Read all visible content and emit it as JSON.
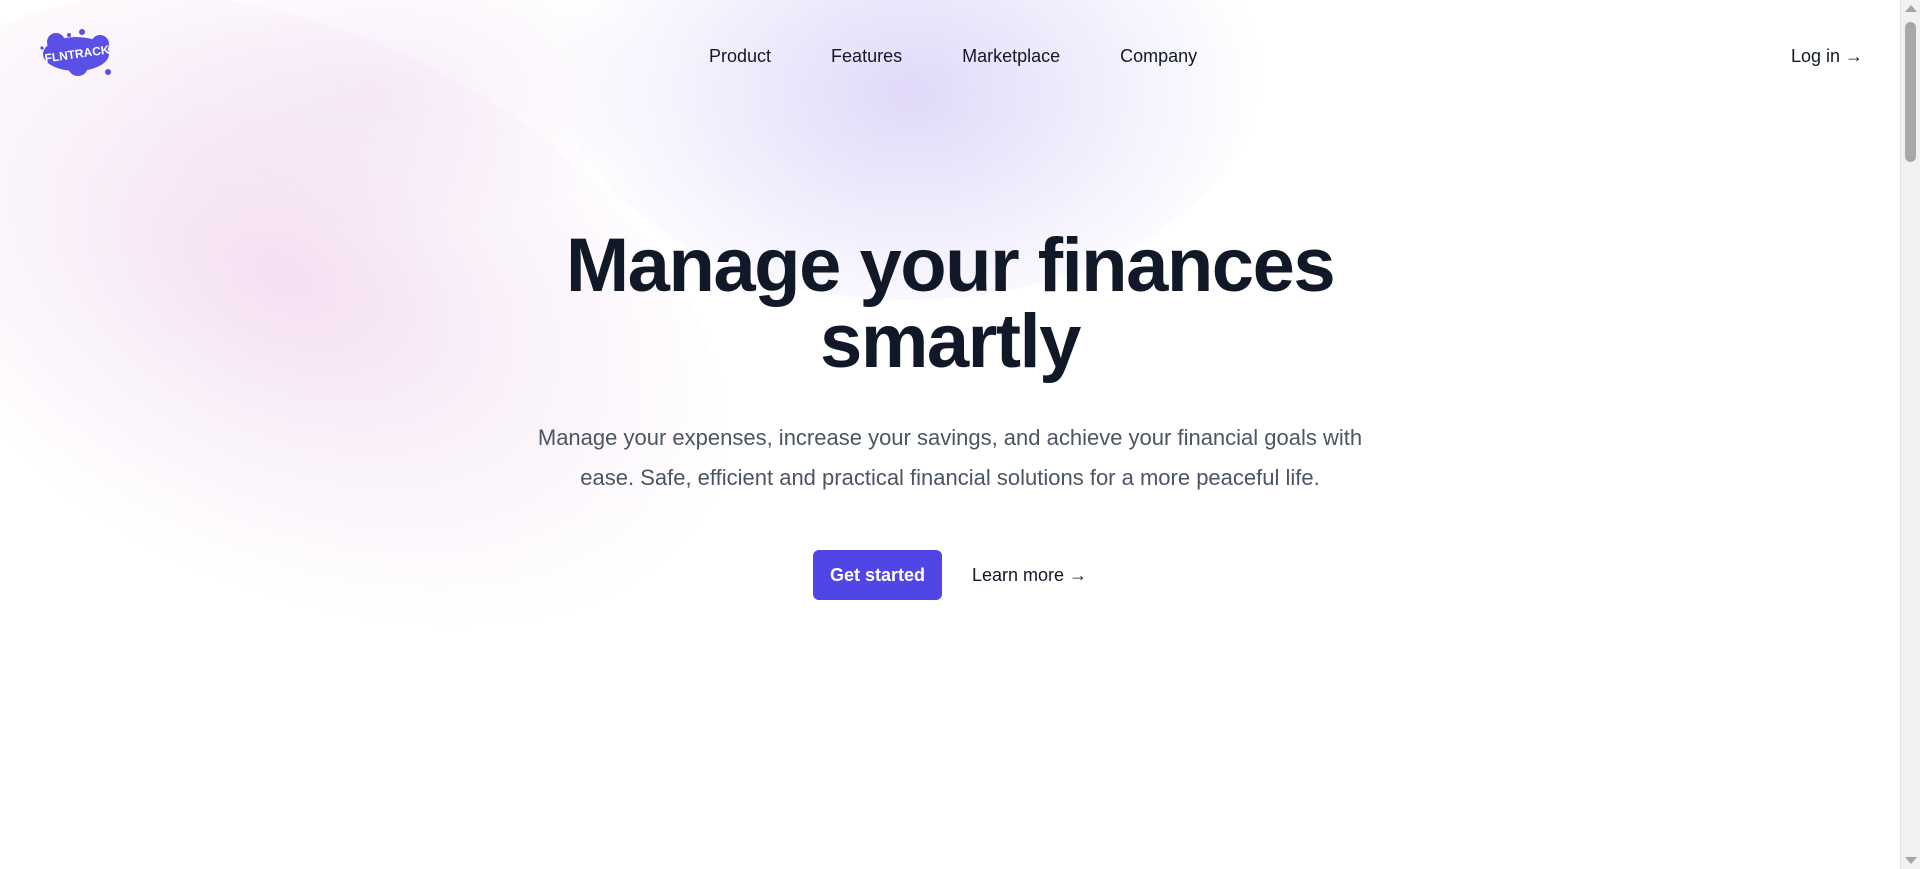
{
  "header": {
    "logo_text": "FLNTRACK",
    "nav": [
      {
        "label": "Product"
      },
      {
        "label": "Features"
      },
      {
        "label": "Marketplace"
      },
      {
        "label": "Company"
      }
    ],
    "login_label": "Log in →"
  },
  "hero": {
    "title_line1": "Manage your finances",
    "title_line2": "smartly",
    "subtitle": "Manage your expenses, increase your savings, and achieve your financial goals with ease. Safe, efficient and practical financial solutions for a more peaceful life.",
    "primary_cta": "Get started",
    "secondary_cta": "Learn more →"
  },
  "colors": {
    "brand": "#4f46e5",
    "text": "#111827",
    "muted": "#4b5563"
  }
}
